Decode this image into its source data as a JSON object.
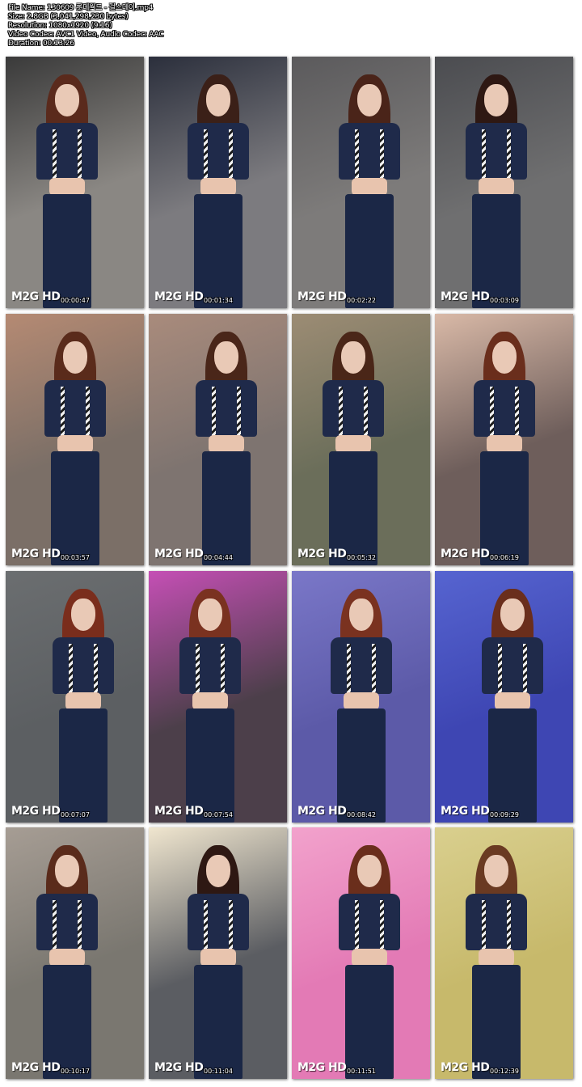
{
  "file_info": {
    "file_name": "File Name: 130609 롯데월드 - 걸스데이.mp4",
    "size": "Size: 2.8GB (3,041,298,230 bytes)",
    "resolution": "Resolution: 1080x1920 (9:16)",
    "codec": "Video Codec: AVC1 Video, Audio Codec: AAC",
    "duration": "Duration: 00:13:26"
  },
  "watermark": "M2G HD",
  "thumbnails": [
    {
      "timestamp": "00:00:47",
      "bg": "#8a8783",
      "accent": "#3a3a3a",
      "hair": "#5a2a1c"
    },
    {
      "timestamp": "00:01:34",
      "bg": "#7c7b7f",
      "accent": "#2b2f3c",
      "hair": "#3b2018"
    },
    {
      "timestamp": "00:02:22",
      "bg": "#7d7b7a",
      "accent": "#5b5a5c",
      "hair": "#4a2419"
    },
    {
      "timestamp": "00:03:09",
      "bg": "#6f6f70",
      "accent": "#4b4c50",
      "hair": "#2e1813"
    },
    {
      "timestamp": "00:03:57",
      "bg": "#7b6f67",
      "accent": "#b58a73",
      "hair": "#5a2b1b"
    },
    {
      "timestamp": "00:04:44",
      "bg": "#7e7470",
      "accent": "#a98b7c",
      "hair": "#4a2619"
    },
    {
      "timestamp": "00:05:32",
      "bg": "#6b6e5a",
      "accent": "#9c8c74",
      "hair": "#4a2618"
    },
    {
      "timestamp": "00:06:19",
      "bg": "#6e5e5b",
      "accent": "#d9b9a7",
      "hair": "#6a2e1c"
    },
    {
      "timestamp": "00:07:07",
      "bg": "#5c5f62",
      "accent": "#6b6e70",
      "hair": "#7a2d1c"
    },
    {
      "timestamp": "00:07:54",
      "bg": "#4c3f4a",
      "accent": "#c54fb5",
      "hair": "#7a3220"
    },
    {
      "timestamp": "00:08:42",
      "bg": "#5c5aa8",
      "accent": "#7a77c8",
      "hair": "#7a3220"
    },
    {
      "timestamp": "00:09:29",
      "bg": "#3e46b3",
      "accent": "#5664d0",
      "hair": "#6a2e1c"
    },
    {
      "timestamp": "00:10:17",
      "bg": "#7a7770",
      "accent": "#a69d94",
      "hair": "#5a2b1b"
    },
    {
      "timestamp": "00:11:04",
      "bg": "#5b5d62",
      "accent": "#f0e6cf",
      "hair": "#2e1813"
    },
    {
      "timestamp": "00:11:51",
      "bg": "#e37ab5",
      "accent": "#f2a2cc",
      "hair": "#6a2e1c"
    },
    {
      "timestamp": "00:12:39",
      "bg": "#c7b96b",
      "accent": "#d9cf8e",
      "hair": "#6a3a22"
    }
  ]
}
